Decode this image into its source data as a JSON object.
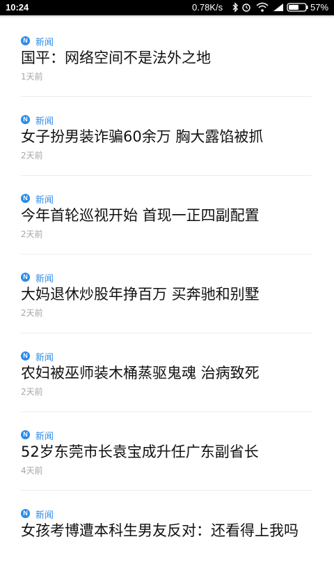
{
  "status_bar": {
    "time": "10:24",
    "network_speed": "0.78K/s",
    "battery_percent": "57%",
    "icons": [
      "bluetooth-icon",
      "alarm-icon",
      "wifi-icon",
      "signal-icon",
      "battery-icon"
    ]
  },
  "news": [
    {
      "source": "新闻",
      "title": "国平：网络空间不是法外之地",
      "time": "1天前"
    },
    {
      "source": "新闻",
      "title": "女子扮男装诈骗60余万 胸大露馅被抓",
      "time": "2天前"
    },
    {
      "source": "新闻",
      "title": "今年首轮巡视开始 首现一正四副配置",
      "time": "2天前"
    },
    {
      "source": "新闻",
      "title": "大妈退休炒股年挣百万 买奔驰和别墅",
      "time": "2天前"
    },
    {
      "source": "新闻",
      "title": "农妇被巫师装木桶蒸驱鬼魂 治病致死",
      "time": "2天前"
    },
    {
      "source": "新闻",
      "title": "52岁东莞市长袁宝成升任广东副省长",
      "time": "4天前"
    },
    {
      "source": "新闻",
      "title": "女孩考博遭本科生男友反对：还看得上我吗",
      "time": ""
    }
  ],
  "colors": {
    "accent": "#2f8ce6",
    "title_text": "#111111",
    "meta_text": "#a6a6a6",
    "status_bar_bg": "#000000"
  }
}
